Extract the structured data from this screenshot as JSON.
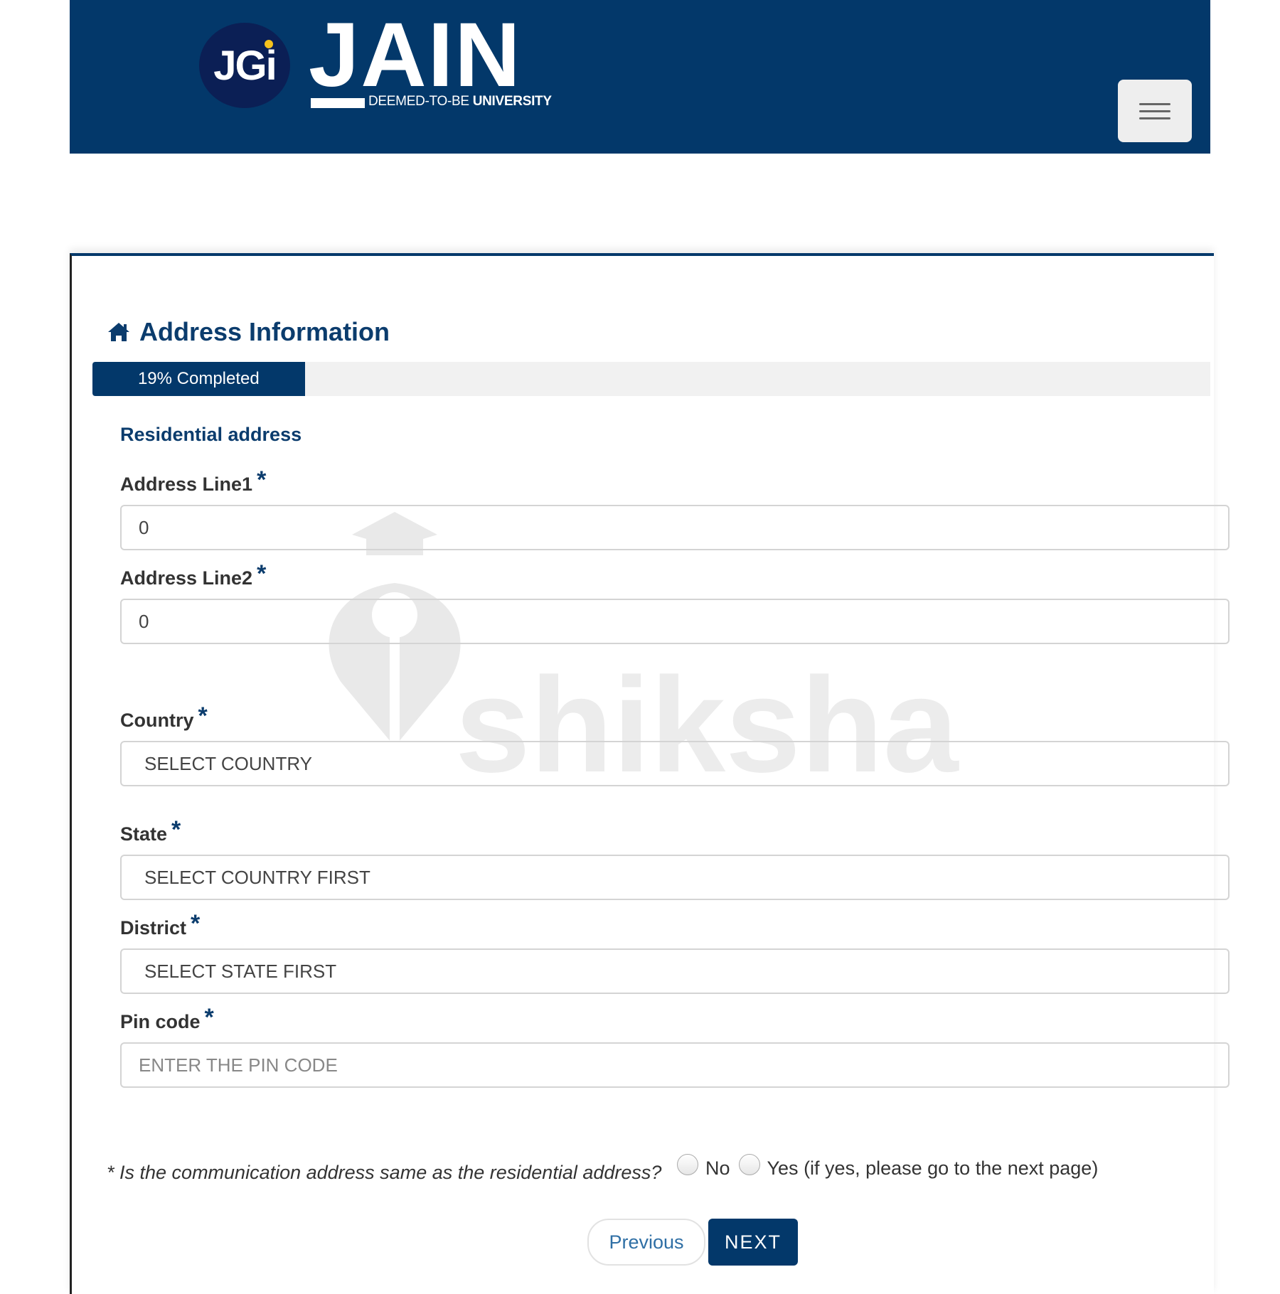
{
  "header": {
    "logo_badge": "JGi",
    "logo_word": "JAIN",
    "logo_subtitle_prefix": "DEEMED-TO-BE ",
    "logo_subtitle_strong": "UNIVERSITY",
    "menu_icon": "hamburger-menu-icon"
  },
  "section": {
    "icon": "home-icon",
    "title": "Address Information"
  },
  "progress": {
    "percent": 19,
    "label": "19% Completed"
  },
  "form": {
    "subheading": "Residential address",
    "required_marker": "*",
    "address_line1": {
      "label": "Address Line1",
      "value": "0"
    },
    "address_line2": {
      "label": "Address Line2",
      "value": "0"
    },
    "country": {
      "label": "Country",
      "value": "SELECT COUNTRY"
    },
    "state": {
      "label": "State",
      "value": "SELECT COUNTRY FIRST"
    },
    "district": {
      "label": "District",
      "value": "SELECT STATE FIRST"
    },
    "pincode": {
      "label": "Pin code",
      "placeholder": "ENTER THE PIN CODE",
      "value": ""
    },
    "question": "* Is the communication address same as the residential address?",
    "option_no": "No",
    "option_yes": "Yes (if yes, please go to the next page)"
  },
  "buttons": {
    "previous": "Previous",
    "next": "NEXT"
  },
  "watermark": {
    "text": "shiksha"
  },
  "colors": {
    "brand_navy": "#03386a",
    "accent_yellow": "#f6c21c",
    "progress_track": "#f1f1f1"
  }
}
